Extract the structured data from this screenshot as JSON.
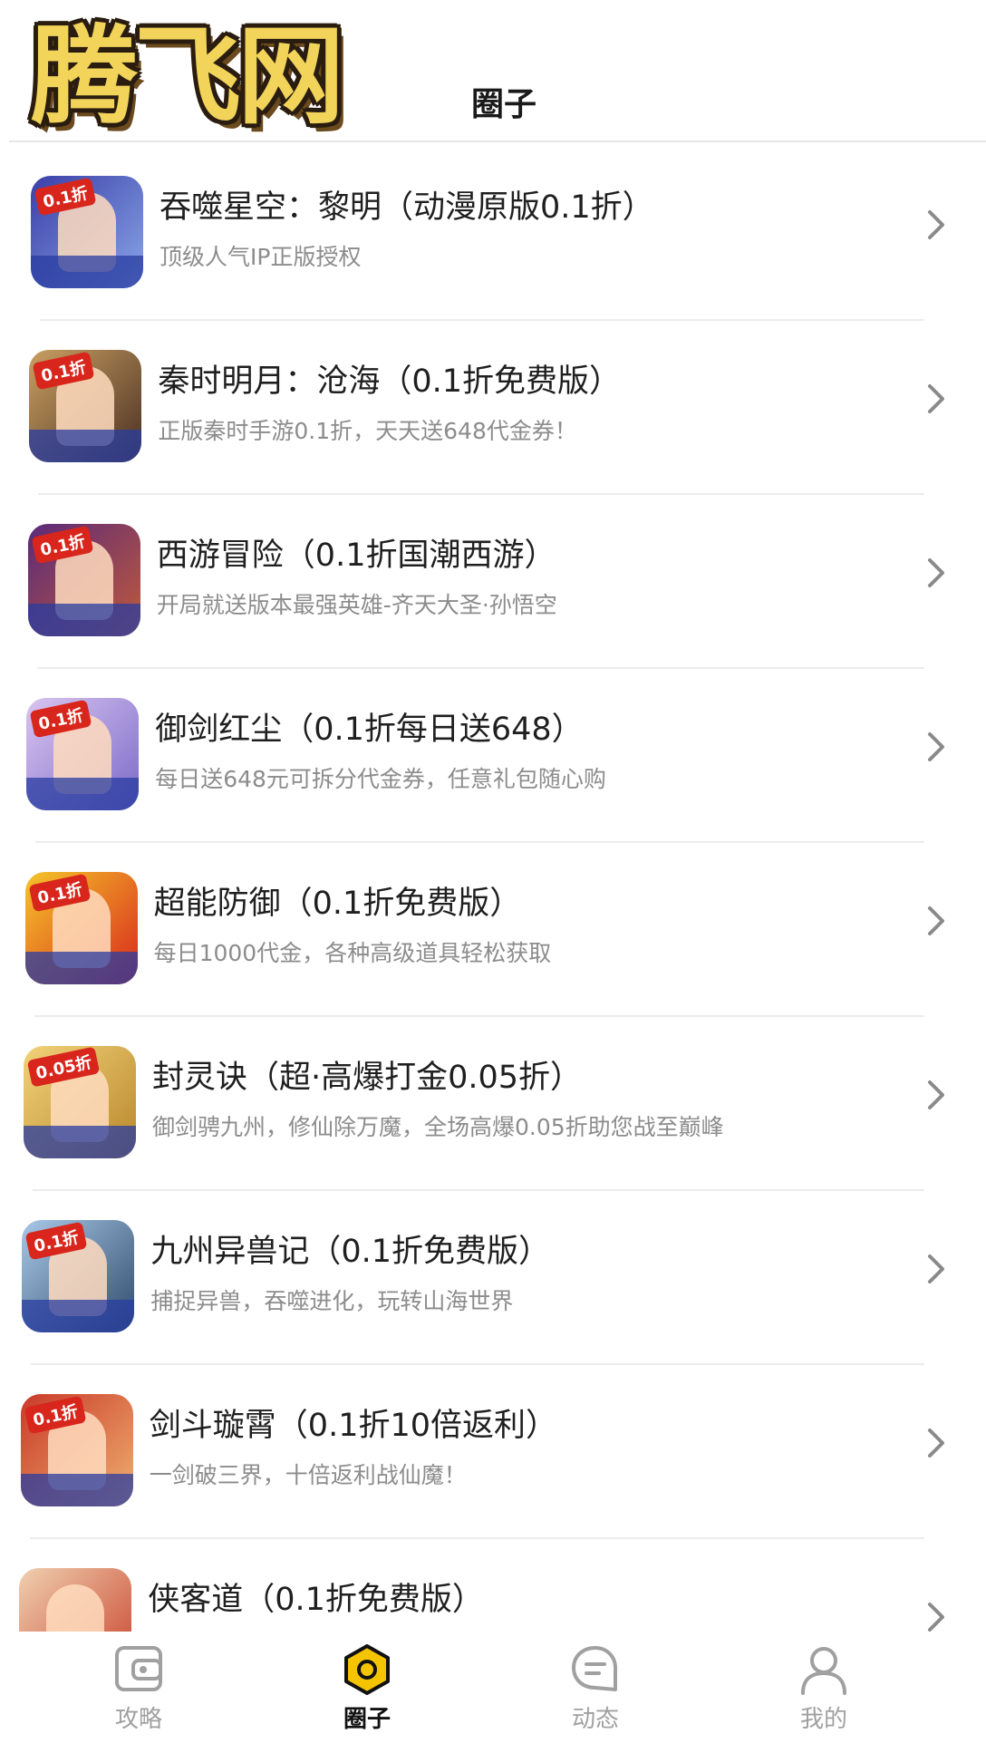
{
  "header": {
    "logo_text": "腾飞网",
    "title": "圈子"
  },
  "colors": {
    "accent": "#f5c400",
    "chevron": "#8a8a8a",
    "badge_red": "#d8261c"
  },
  "games": [
    {
      "title": "吞噬星空：黎明（动漫原版0.1折）",
      "desc": "顶级人气IP正版授权",
      "badge": "0.1折",
      "bg1": "#3a3fa8",
      "bg2": "#8aa6e8"
    },
    {
      "title": "秦时明月：沧海（0.1折免费版）",
      "desc": "正版秦时手游0.1折，天天送648代金券！",
      "badge": "0.1折",
      "bg1": "#c9a062",
      "bg2": "#4a2f22"
    },
    {
      "title": "西游冒险（0.1折国潮西游）",
      "desc": "开局就送版本最强英雄-齐天大圣·孙悟空",
      "badge": "0.1折",
      "bg1": "#5b2a7a",
      "bg2": "#c05a3a"
    },
    {
      "title": "御剑红尘（0.1折每日送648）",
      "desc": "每日送648元可拆分代金券，任意礼包随心购",
      "badge": "0.1折",
      "bg1": "#d9c4f0",
      "bg2": "#7a6ac8"
    },
    {
      "title": "超能防御（0.1折免费版）",
      "desc": "每日1000代金，各种高级道具轻松获取",
      "badge": "0.1折",
      "bg1": "#f5c52a",
      "bg2": "#d8261c"
    },
    {
      "title": "封灵诀（超·高爆打金0.05折）",
      "desc": "御剑骋九州，修仙除万魔，全场高爆0.05折助您战至巅峰",
      "badge": "0.05折",
      "bg1": "#f2d27a",
      "bg2": "#b8862a"
    },
    {
      "title": "九州异兽记（0.1折免费版）",
      "desc": "捕捉异兽，吞噬进化，玩转山海世界",
      "badge": "0.1折",
      "bg1": "#a9c8e8",
      "bg2": "#2f4a6a"
    },
    {
      "title": "剑斗璇霄（0.1折10倍返利）",
      "desc": "一剑破三界，十倍返利战仙魔！",
      "badge": "0.1折",
      "bg1": "#c83a2a",
      "bg2": "#f0b070"
    },
    {
      "title": "侠客道（0.1折免费版）",
      "desc": "",
      "badge": "",
      "bg1": "#f0d0b0",
      "bg2": "#c8402a"
    }
  ],
  "tabs": [
    {
      "label": "攻略",
      "icon": "wallet-icon"
    },
    {
      "label": "圈子",
      "icon": "circle-hexagon-icon"
    },
    {
      "label": "动态",
      "icon": "message-icon"
    },
    {
      "label": "我的",
      "icon": "user-icon"
    }
  ]
}
